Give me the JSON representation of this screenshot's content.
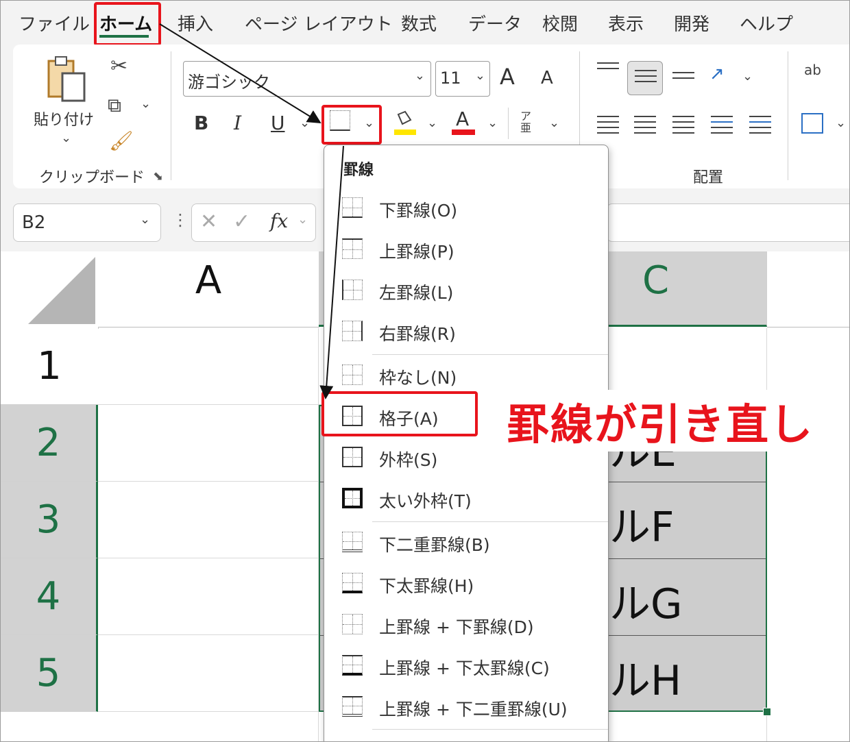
{
  "tabs": [
    "ファイル",
    "ホーム",
    "挿入",
    "ページ レイアウト",
    "数式",
    "データ",
    "校閲",
    "表示",
    "開発",
    "ヘルプ"
  ],
  "ribbon": {
    "paste_label": "貼り付け",
    "clipboard_group": "クリップボード",
    "alignment_group": "配置",
    "font_name": "游ゴシック",
    "font_size": "11",
    "bold": "B",
    "italic": "I",
    "underline": "U",
    "font_color": "A",
    "grow_font": "A",
    "shrink_font": "A",
    "phonetic": "ア亜",
    "wrap_icon": "ab"
  },
  "formula_bar": {
    "name_box": "B2",
    "fx": "fx"
  },
  "grid": {
    "columns": [
      "A",
      "C"
    ],
    "rows": [
      "1",
      "2",
      "3",
      "4",
      "5"
    ],
    "cells": [
      "ルE",
      "ルF",
      "ルG",
      "ルH"
    ]
  },
  "border_menu": {
    "title": "罫線",
    "items": [
      "下罫線(O)",
      "上罫線(P)",
      "左罫線(L)",
      "右罫線(R)",
      "枠なし(N)",
      "格子(A)",
      "外枠(S)",
      "太い外枠(T)",
      "下二重罫線(B)",
      "下太罫線(H)",
      "上罫線 + 下罫線(D)",
      "上罫線 + 下太罫線(C)",
      "上罫線 + 下二重罫線(U)"
    ]
  },
  "annotation": "罫線が引き直し",
  "colors": {
    "accent_green": "#1e7145",
    "highlight_red": "#e8141c",
    "selection_fill": "#cccccc",
    "fill_yellow": "#ffe600"
  }
}
